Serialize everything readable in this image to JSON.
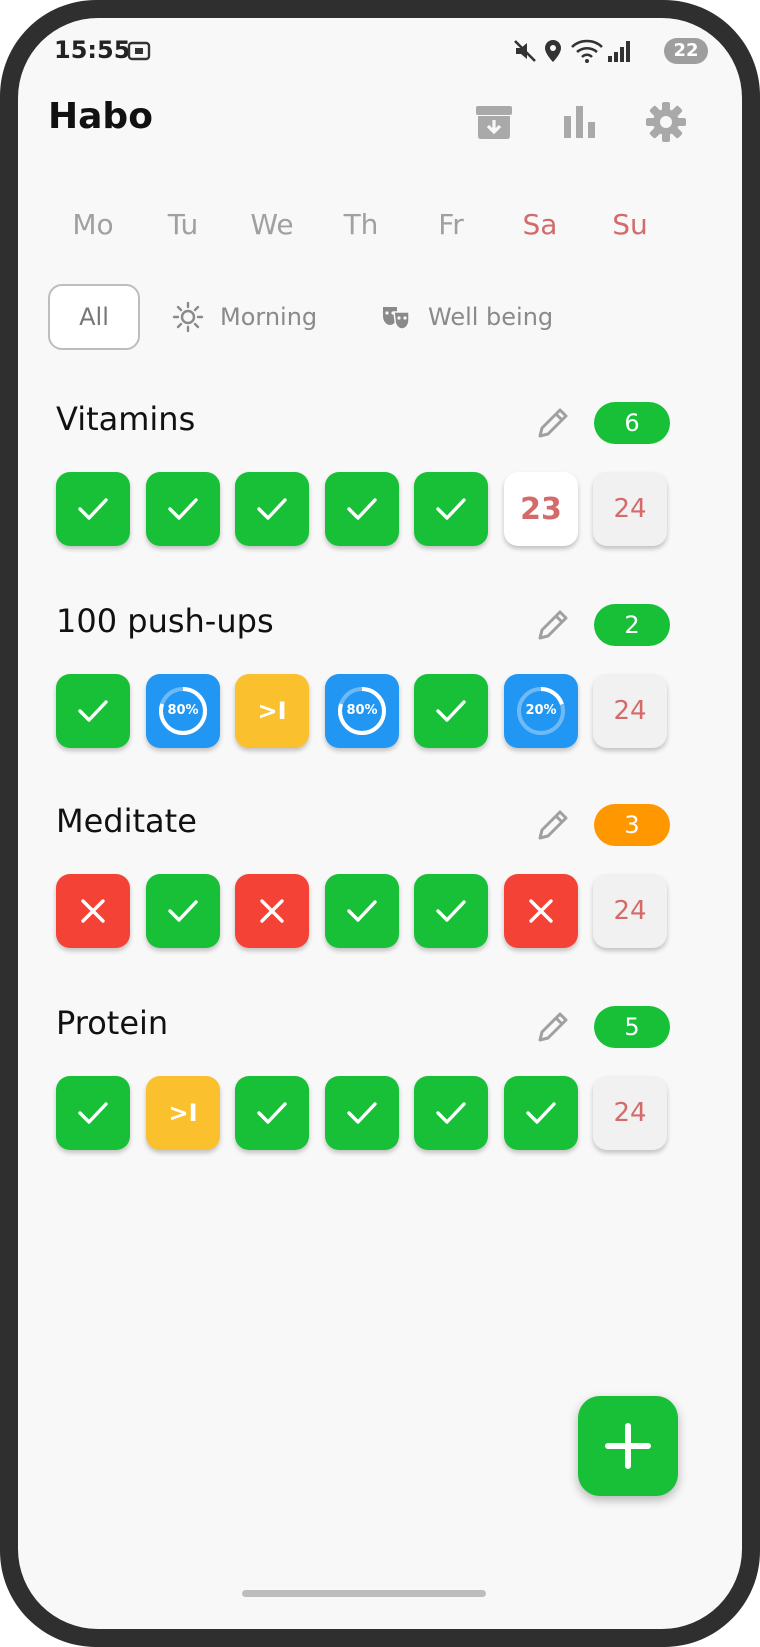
{
  "status_bar": {
    "time": "15:55",
    "battery": "22"
  },
  "app_bar": {
    "title": "Habo"
  },
  "weekdays": [
    "Mo",
    "Tu",
    "We",
    "Th",
    "Fr",
    "Sa",
    "Su"
  ],
  "filters": {
    "all": "All",
    "morning": "Morning",
    "well_being": "Well being"
  },
  "colors": {
    "check": "#17c037",
    "fail": "#f44336",
    "skip": "#fbc02d",
    "progress": "#2196f3",
    "streak_orange": "#ff9800",
    "weekend": "#d46a6a"
  },
  "habits": [
    {
      "name": "Vitamins",
      "streak": "6",
      "streak_color": "green",
      "days": [
        {
          "state": "check"
        },
        {
          "state": "check"
        },
        {
          "state": "check"
        },
        {
          "state": "check"
        },
        {
          "state": "check"
        },
        {
          "state": "today",
          "label": "23"
        },
        {
          "state": "future",
          "label": "24"
        }
      ]
    },
    {
      "name": "100 push-ups",
      "streak": "2",
      "streak_color": "green",
      "days": [
        {
          "state": "check"
        },
        {
          "state": "progress",
          "label": "80%",
          "value": 0.8
        },
        {
          "state": "skip",
          "label": ">I"
        },
        {
          "state": "progress",
          "label": "80%",
          "value": 0.8
        },
        {
          "state": "check"
        },
        {
          "state": "progress",
          "label": "20%",
          "value": 0.2
        },
        {
          "state": "future",
          "label": "24"
        }
      ]
    },
    {
      "name": "Meditate",
      "streak": "3",
      "streak_color": "orange",
      "days": [
        {
          "state": "fail"
        },
        {
          "state": "check"
        },
        {
          "state": "fail"
        },
        {
          "state": "check"
        },
        {
          "state": "check"
        },
        {
          "state": "fail"
        },
        {
          "state": "future",
          "label": "24"
        }
      ]
    },
    {
      "name": "Protein",
      "streak": "5",
      "streak_color": "green",
      "days": [
        {
          "state": "check"
        },
        {
          "state": "skip",
          "label": ">I"
        },
        {
          "state": "check"
        },
        {
          "state": "check"
        },
        {
          "state": "check"
        },
        {
          "state": "check"
        },
        {
          "state": "future",
          "label": "24"
        }
      ]
    }
  ],
  "fab": {
    "icon": "plus-icon"
  }
}
